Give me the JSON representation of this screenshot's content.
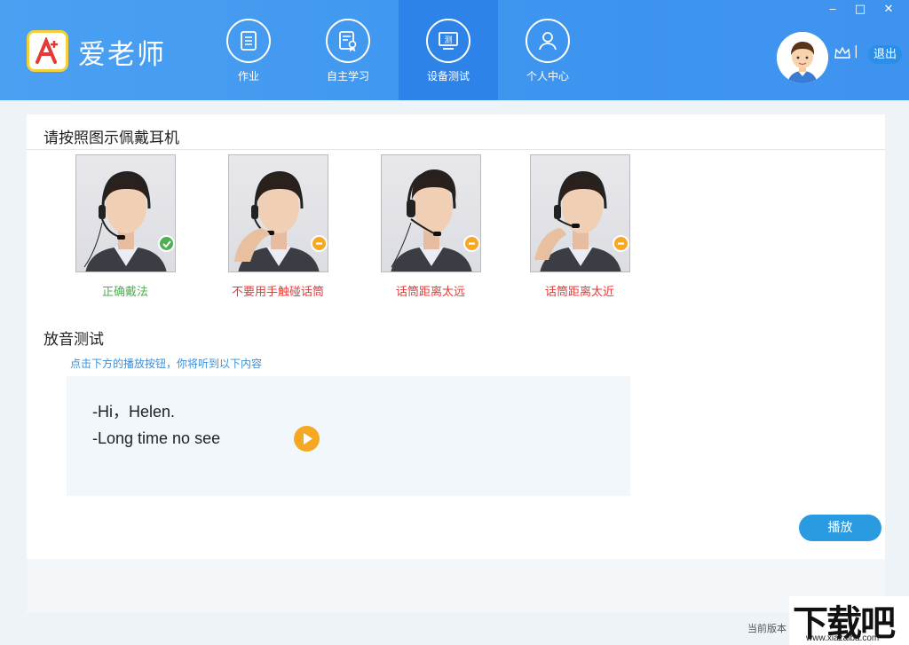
{
  "app": {
    "title": "爱老师",
    "logo_text": "A"
  },
  "window_controls": {
    "minimize": "‒",
    "maximize": "□",
    "close": "✕"
  },
  "nav": [
    {
      "label": "作业",
      "icon": "clipboard-icon"
    },
    {
      "label": "自主学习",
      "icon": "certificate-icon"
    },
    {
      "label": "设备测试",
      "icon": "test-monitor-icon",
      "icon_text": "测",
      "active": true
    },
    {
      "label": "个人中心",
      "icon": "user-icon"
    }
  ],
  "user": {
    "logout_label": "退出",
    "separator": "|"
  },
  "headset_section": {
    "title": "请按照图示佩戴耳机",
    "items": [
      {
        "caption": "正确戴法",
        "status": "correct",
        "color": "#4caf50"
      },
      {
        "caption": "不要用手触碰话筒",
        "status": "wrong",
        "color": "#e53935"
      },
      {
        "caption": "话筒距离太远",
        "status": "wrong",
        "color": "#e53935"
      },
      {
        "caption": "话筒距离太近",
        "status": "wrong",
        "color": "#e53935"
      }
    ]
  },
  "playback_section": {
    "title": "放音测试",
    "hint": "点击下方的播放按钮，你将听到以下内容",
    "lines": [
      "-Hi，Helen.",
      "-Long time no see"
    ],
    "play_button_label": "播放"
  },
  "footer": {
    "version_label": "当前版本"
  },
  "watermark": {
    "text": "下载吧",
    "url": "www.xiazaiba.com"
  },
  "colors": {
    "header": "#4ba0f2",
    "active_tab": "#2d83e8",
    "accent_orange": "#f7a823",
    "button_blue": "#2a9be0"
  }
}
